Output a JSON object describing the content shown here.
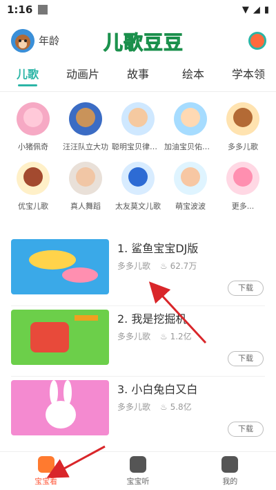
{
  "status": {
    "time": "1:16"
  },
  "header": {
    "age_label": "年龄",
    "logo_text": "儿歌豆豆"
  },
  "tabs": [
    {
      "label": "儿歌",
      "active": true
    },
    {
      "label": "动画片"
    },
    {
      "label": "故事"
    },
    {
      "label": "绘本"
    },
    {
      "label": "学本领"
    }
  ],
  "categories": [
    {
      "label": "小猪佩奇",
      "color": "#f6a9c4",
      "face": "#ffc9d9"
    },
    {
      "label": "汪汪队立大功",
      "color": "#3b6cc4",
      "face": "#c9935a"
    },
    {
      "label": "聪明宝贝律动...",
      "color": "#cfe8ff",
      "face": "#f5c9a0"
    },
    {
      "label": "加油宝贝佑佑...",
      "color": "#a6dcff",
      "face": "#ffd9b3"
    },
    {
      "label": "多多儿歌",
      "color": "#ffe3b0",
      "face": "#b36a35"
    },
    {
      "label": "优宝儿歌",
      "color": "#fff0c8",
      "face": "#a34a2f"
    },
    {
      "label": "真人舞蹈",
      "color": "#e9e0d8",
      "face": "#f1c6a5"
    },
    {
      "label": "太友莫文儿歌",
      "color": "#d8ecff",
      "face": "#2d6bd4"
    },
    {
      "label": "萌宝波波",
      "color": "#dff4ff",
      "face": "#f7c7a3"
    },
    {
      "label": "更多...",
      "color": "#ffd8e4",
      "face": "#ff8fb0"
    }
  ],
  "songs": [
    {
      "title": "1. 鲨鱼宝宝DJ版",
      "source": "多多儿歌",
      "plays": "62.7万",
      "download": "下载",
      "thumb_bg": "#3aa9e8",
      "thumb_fg": "#ffd34a"
    },
    {
      "title": "2. 我是挖掘机",
      "source": "多多儿歌",
      "plays": "1.2亿",
      "download": "下载",
      "thumb_bg": "#6ccf4a",
      "thumb_fg": "#e84a3a"
    },
    {
      "title": "3. 小白兔白又白",
      "source": "多多儿歌",
      "plays": "5.8亿",
      "download": "下载",
      "thumb_bg": "#f48ad0",
      "thumb_fg": "#ffffff"
    }
  ],
  "bottom_nav": [
    {
      "label": "宝宝看",
      "active": true,
      "color": "#ff7a2f"
    },
    {
      "label": "宝宝听",
      "color": "#555555"
    },
    {
      "label": "我的",
      "color": "#555555"
    }
  ],
  "colors": {
    "accent": "#2bb5a6",
    "logo": "#2fc06b",
    "annotation_arrow": "#d9262a"
  }
}
